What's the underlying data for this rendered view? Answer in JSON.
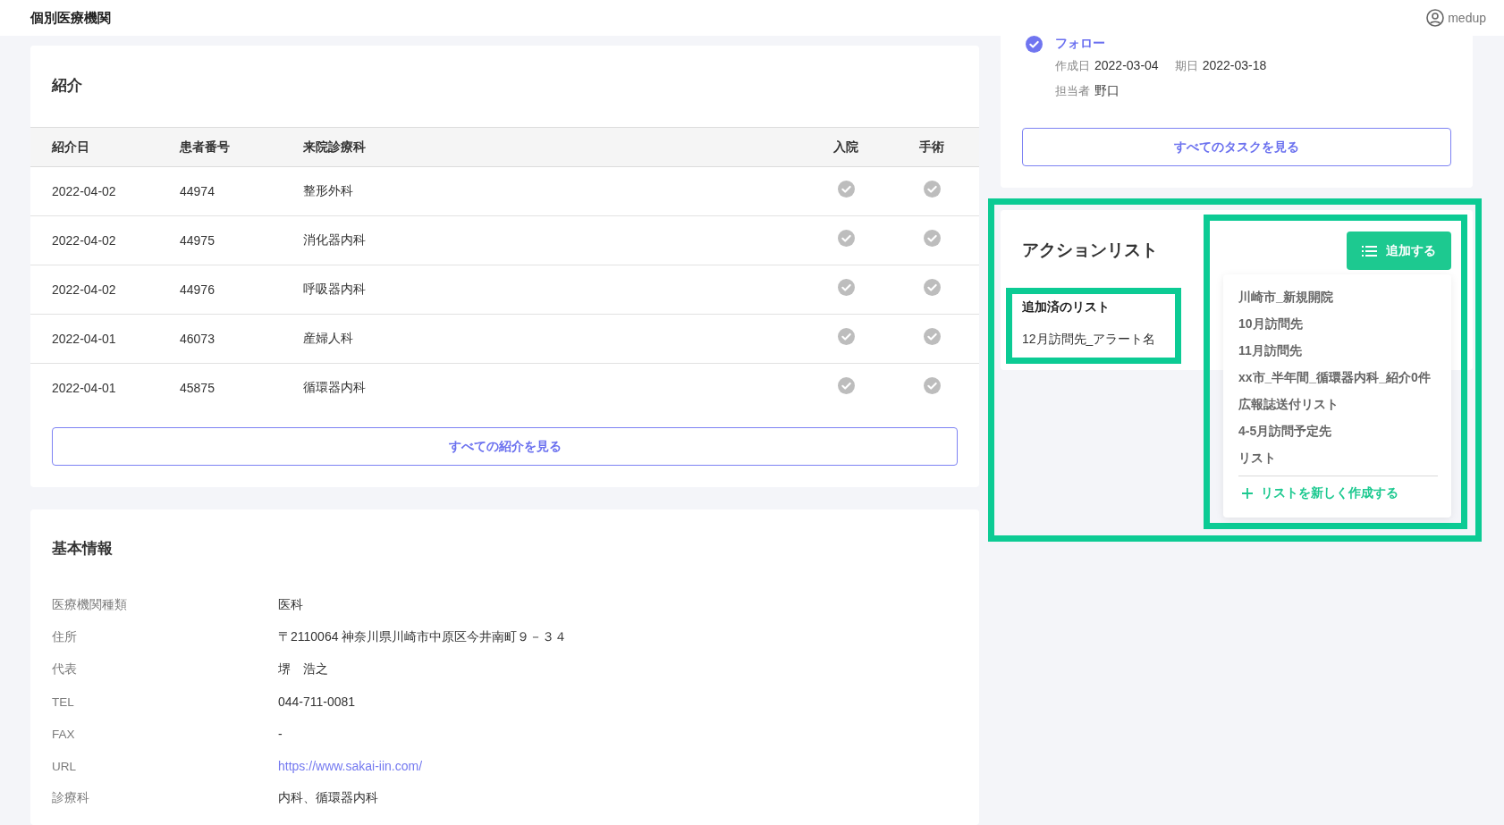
{
  "header": {
    "title": "個別医療機関",
    "user": "medup"
  },
  "referrals": {
    "title": "紹介",
    "columns": [
      "紹介日",
      "患者番号",
      "来院診療科",
      "入院",
      "手術"
    ],
    "rows": [
      {
        "date": "2022-04-02",
        "patient_no": "44974",
        "department": "整形外科",
        "admitted": true,
        "surgery": true
      },
      {
        "date": "2022-04-02",
        "patient_no": "44975",
        "department": "消化器内科",
        "admitted": true,
        "surgery": true
      },
      {
        "date": "2022-04-02",
        "patient_no": "44976",
        "department": "呼吸器内科",
        "admitted": true,
        "surgery": true
      },
      {
        "date": "2022-04-01",
        "patient_no": "46073",
        "department": "産婦人科",
        "admitted": true,
        "surgery": true
      },
      {
        "date": "2022-04-01",
        "patient_no": "45875",
        "department": "循環器内科",
        "admitted": true,
        "surgery": true
      }
    ],
    "button": "すべての紹介を見る"
  },
  "basic_info": {
    "title": "基本情報",
    "fields": [
      {
        "label": "医療機関種類",
        "value": "医科",
        "kind": "text"
      },
      {
        "label": "住所",
        "value": "〒2110064 神奈川県川崎市中原区今井南町９－３４",
        "kind": "text"
      },
      {
        "label": "代表",
        "value": "堺　浩之",
        "kind": "text"
      },
      {
        "label": "TEL",
        "value": "044-711-0081",
        "kind": "text"
      },
      {
        "label": "FAX",
        "value": "-",
        "kind": "text"
      },
      {
        "label": "URL",
        "value": "https://www.sakai-iin.com/",
        "kind": "link"
      },
      {
        "label": "診療科",
        "value": "内科、循環器内科",
        "kind": "text"
      }
    ]
  },
  "task": {
    "title": "フォロー",
    "done": true,
    "created_label": "作成日",
    "created": "2022-03-04",
    "due_label": "期日",
    "due": "2022-03-18",
    "assignee_label": "担当者",
    "assignee": "野口",
    "button": "すべてのタスクを見る"
  },
  "action_list": {
    "title": "アクションリスト",
    "highlighted": true,
    "added_lists": {
      "title": "追加済のリスト",
      "items": [
        "12月訪問先_アラート名"
      ],
      "highlighted": true
    },
    "add_menu": {
      "button": "追加する",
      "highlighted": true,
      "items": [
        "川崎市_新規開院",
        "10月訪問先",
        "11月訪問先",
        "xx市_半年間_循環器内科_紹介0件",
        "広報誌送付リスト",
        "4-5月訪問予定先",
        "リスト"
      ],
      "create_item": "リストを新しく作成する"
    }
  }
}
